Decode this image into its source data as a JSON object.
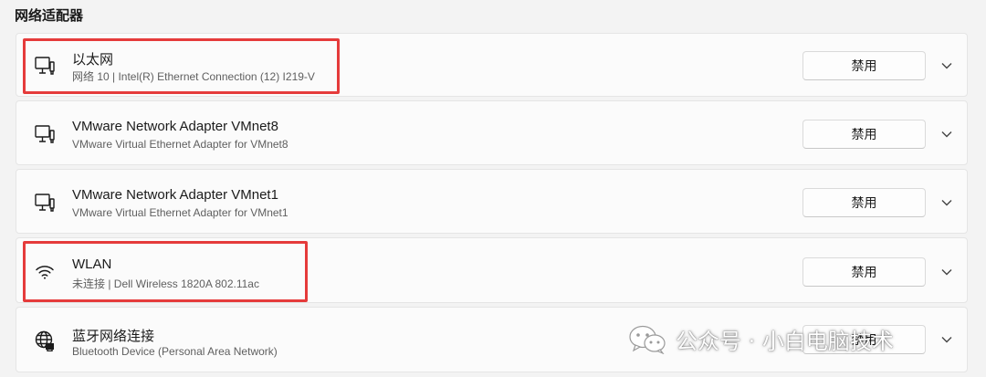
{
  "section_title": "网络适配器",
  "adapters": [
    {
      "name": "以太网",
      "description": "网络 10 | Intel(R) Ethernet Connection (12) I219-V",
      "icon": "wired-network-icon",
      "button_label": "禁用"
    },
    {
      "name": "VMware Network Adapter VMnet8",
      "description": "VMware Virtual Ethernet Adapter for VMnet8",
      "icon": "wired-network-icon",
      "button_label": "禁用"
    },
    {
      "name": "VMware Network Adapter VMnet1",
      "description": "VMware Virtual Ethernet Adapter for VMnet1",
      "icon": "wired-network-icon",
      "button_label": "禁用"
    },
    {
      "name": "WLAN",
      "description": "未连接 | Dell Wireless 1820A 802.11ac",
      "icon": "wifi-icon",
      "button_label": "禁用"
    },
    {
      "name": "蓝牙网络连接",
      "description": "Bluetooth Device (Personal Area Network)",
      "icon": "globe-network-icon",
      "button_label": "禁用"
    }
  ],
  "watermark": {
    "text": "公众号 · 小白电脑技术",
    "icon": "wechat-logo"
  },
  "colors": {
    "highlight_border": "#e53b3b",
    "card_background": "#fbfbfb",
    "page_background": "#f3f3f3"
  }
}
